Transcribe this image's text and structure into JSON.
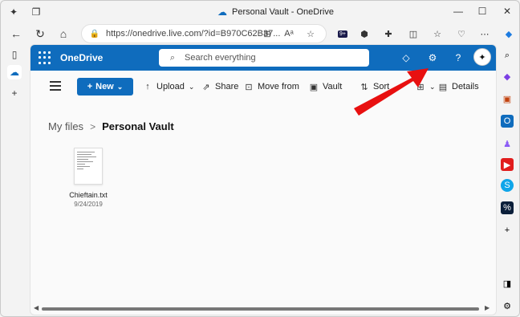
{
  "browser": {
    "tab_title": "Personal Vault - OneDrive",
    "url": "https://onedrive.live.com/?id=B970C62B37...",
    "badge": "9+"
  },
  "app": {
    "brand": "OneDrive",
    "search_placeholder": "Search everything"
  },
  "toolbar": {
    "new_label": "New",
    "upload_label": "Upload",
    "share_label": "Share",
    "move_label": "Move from",
    "vault_label": "Vault",
    "sort_label": "Sort",
    "details_label": "Details"
  },
  "breadcrumb": {
    "parent": "My files",
    "separator": ">",
    "current": "Personal Vault"
  },
  "files": [
    {
      "name": "Chieftain.txt",
      "date": "9/24/2019"
    }
  ],
  "icons": {
    "settings": "gear-icon",
    "premium": "diamond-icon",
    "help": "question-icon"
  },
  "colors": {
    "accent": "#0f6cbd",
    "annotation_arrow": "#e81010"
  }
}
